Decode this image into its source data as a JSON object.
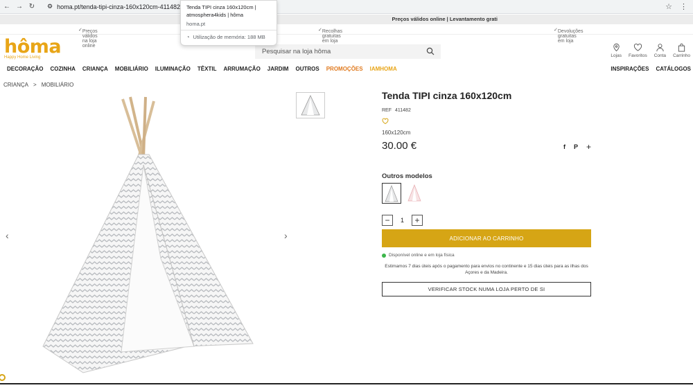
{
  "browser": {
    "url": "homa.pt/tenda-tipi-cinza-160x120cm-411482.html",
    "tab_tooltip": {
      "title": "Tenda TIPI cinza 160x120cm | atmosphera4kids | hôma",
      "domain": "homa.pt",
      "memory": "Utilização de memória: 188 MB"
    }
  },
  "promo_bar": "Preços válidos online | Levantamento grati",
  "benefits": [
    "Preços válidos na loja online",
    "Recolhas gratuitas em loja",
    "Devoluções gratuitas em loja"
  ],
  "logo": {
    "word": "hôma",
    "tagline": "Happy Home Living"
  },
  "search": {
    "placeholder": "Pesquisar na loja hôma"
  },
  "user_icons": [
    {
      "label": "Lojas",
      "icon": "location-pin-icon"
    },
    {
      "label": "Favoritos",
      "icon": "heart-icon"
    },
    {
      "label": "Conta",
      "icon": "user-icon"
    },
    {
      "label": "Carrinho",
      "icon": "bag-icon"
    }
  ],
  "nav": {
    "left": [
      "DECORAÇÃO",
      "COZINHA",
      "CRIANÇA",
      "MOBILIÁRIO",
      "ILUMINAÇÃO",
      "TÊXTIL",
      "ARRUMAÇÃO",
      "JARDIM",
      "OUTROS",
      "PROMOÇÕES",
      "IAMHOMA"
    ],
    "right": [
      "INSPIRAÇÕES",
      "CATÁLOGOS"
    ]
  },
  "breadcrumb": [
    "CRIANÇA",
    ">",
    "MOBILIÁRIO"
  ],
  "product": {
    "title": "Tenda TIPI cinza 160x120cm",
    "ref_label": "REF",
    "ref": "411482",
    "size": "160x120cm",
    "price": "30.00 €",
    "other_models_label": "Outros modelos",
    "quantity": "1",
    "add_to_cart": "ADICIONAR AO CARRINHO",
    "availability": "Disponível online e em loja física",
    "delivery": "Estimamos 7 dias úteis após o pagamento para envios no continente e 15 dias úteis para as ilhas dos Açores e da Madeira.",
    "check_stock": "VERIFICAR STOCK NUMA LOJA PERTO DE SI"
  },
  "colors": {
    "brand": "#e8a517",
    "cart_button": "#d6a515",
    "promo": "#e07a1f",
    "available": "#3cb64b"
  }
}
